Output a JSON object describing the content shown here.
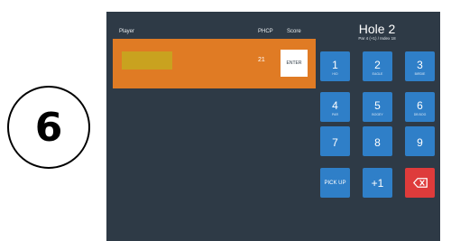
{
  "step": {
    "number": "6"
  },
  "header": {
    "player": "Player",
    "phcp": "PHCP",
    "score": "Score"
  },
  "hole": {
    "title": "Hole 2",
    "subtitle": "Par 4 (+1) / Index 18"
  },
  "row": {
    "phcp": "21",
    "enter_label": "ENTER"
  },
  "keypad": {
    "k1": {
      "num": "1",
      "sub": "HIO"
    },
    "k2": {
      "num": "2",
      "sub": "EAGLE"
    },
    "k3": {
      "num": "3",
      "sub": "BIRDIE"
    },
    "k4": {
      "num": "4",
      "sub": "PAR"
    },
    "k5": {
      "num": "5",
      "sub": "BOGEY"
    },
    "k6": {
      "num": "6",
      "sub": "DB BOG"
    },
    "k7": {
      "num": "7"
    },
    "k8": {
      "num": "8"
    },
    "k9": {
      "num": "9"
    },
    "pickup": "PICK UP",
    "plus_one": "+1"
  },
  "colors": {
    "panel": "#2e3a46",
    "row": "#e07b24",
    "key": "#2f7fc8",
    "backspace": "#de3b3b"
  }
}
